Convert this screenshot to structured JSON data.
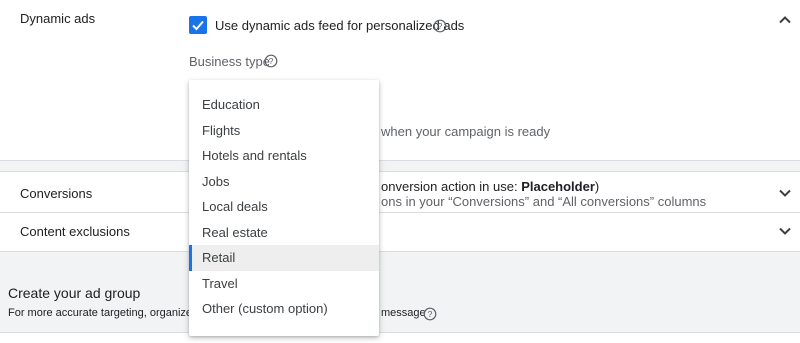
{
  "dynamic_ads": {
    "title": "Dynamic ads",
    "checkbox_label": "Use dynamic ads feed for personalized ads",
    "checkbox_checked": true,
    "business_type_label": "Business type",
    "partial_info": "when your campaign is ready"
  },
  "conversions": {
    "title": "Conversions",
    "info_prefix": "onversion action in use: ",
    "info_value": "Placeholder",
    "info_suffix": ")",
    "info_line2": "ons in your “Conversions” and “All conversions” columns"
  },
  "content_exclusions": {
    "title": "Content exclusions"
  },
  "ad_group": {
    "title": "Create your ad group",
    "subtitle_left": "For more accurate targeting, organize ea",
    "subtitle_right": "message"
  },
  "dropdown": {
    "items": [
      {
        "label": "Education"
      },
      {
        "label": "Flights"
      },
      {
        "label": "Hotels and rentals"
      },
      {
        "label": "Jobs"
      },
      {
        "label": "Local deals"
      },
      {
        "label": "Real estate"
      },
      {
        "label": "Retail"
      },
      {
        "label": "Travel"
      },
      {
        "label": "Other (custom option)"
      }
    ],
    "selected": "Retail"
  },
  "colors": {
    "accent": "#1a73e8",
    "background": "#f1f3f4",
    "divider": "#dadce0",
    "selected_row": "#eeeeee"
  }
}
